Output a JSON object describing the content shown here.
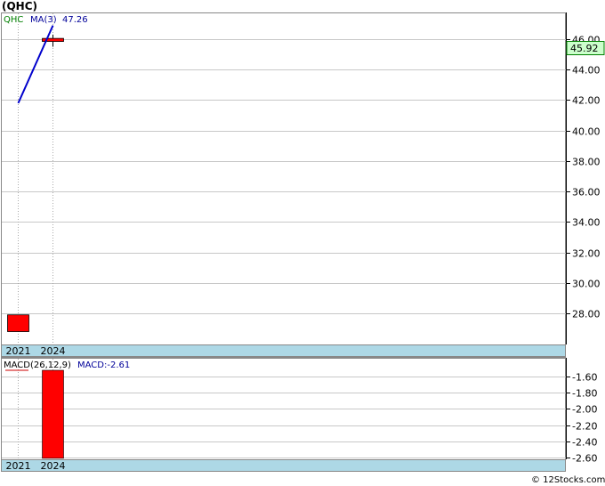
{
  "title": "(QHC)",
  "symbol": "QHC",
  "ma_label": "MA(3)",
  "ma_value": "47.26",
  "last_price_badge": "45.92",
  "macd_label": "MACD(26,12,9)",
  "macd_value": "MACD:-2.61",
  "footer": "© 12Stocks.com",
  "colors": {
    "up_candle": "#ff0000",
    "ma_line": "#0000cc",
    "badge_bg": "#ccffcc",
    "date_band": "#add8e6",
    "symbol_text": "#008000",
    "label_text": "#000099"
  },
  "chart_data": [
    {
      "type": "candlestick",
      "x": [
        "2021",
        "2024"
      ],
      "ohlc": [
        {
          "open": 27.9,
          "high": 27.9,
          "low": 26.8,
          "close": 26.8
        },
        {
          "open": 46.05,
          "high": 46.3,
          "low": 45.5,
          "close": 45.85
        }
      ],
      "ma": {
        "name": "MA(3)",
        "x": [
          "2021",
          "2024"
        ],
        "values": [
          41.8,
          46.9
        ]
      },
      "yticks": [
        "28.00",
        "30.00",
        "32.00",
        "34.00",
        "36.00",
        "38.00",
        "40.00",
        "42.00",
        "44.00",
        "46.00"
      ],
      "ylim": [
        26.2,
        47.7
      ],
      "grid": true,
      "last": 45.92
    },
    {
      "type": "bar",
      "name": "MACD(26,12,9)",
      "x": [
        "2021",
        "2024"
      ],
      "values": [
        null,
        -2.61
      ],
      "yticks": [
        "-1.60",
        "-1.80",
        "-2.00",
        "-2.20",
        "-2.40",
        "-2.60"
      ],
      "ylim": [
        -2.66,
        -1.5
      ],
      "grid": true
    }
  ]
}
